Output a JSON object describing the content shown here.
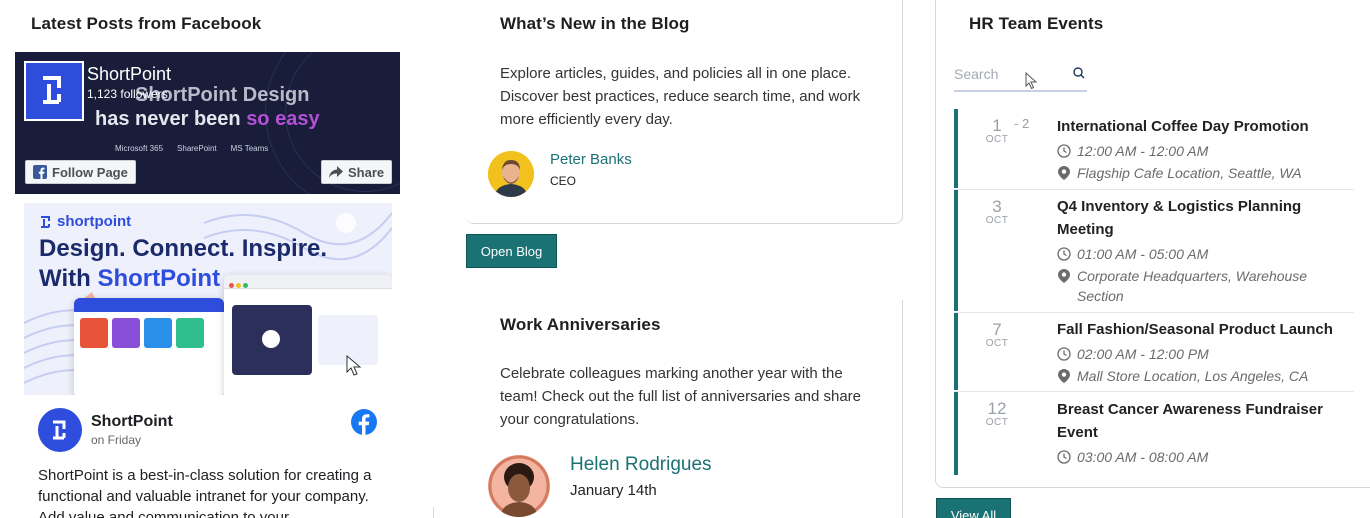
{
  "facebook": {
    "title": "Latest Posts from Facebook",
    "page_name": "ShortPoint",
    "followers": "1,123 followers",
    "banner_tagline_1": "ShortPoint Design",
    "banner_tagline_2_a": "has never been",
    "banner_tagline_2_b": "so easy",
    "partners": [
      "Microsoft 365",
      "SharePoint",
      "MS Teams"
    ],
    "follow_label": "Follow Page",
    "share_label": "Share",
    "card_brand": "shortpoint",
    "card_headline_1": "Design. Connect. Inspire.",
    "card_headline_2a": "With",
    "card_headline_2b": "ShortPoint",
    "post_author": "ShortPoint",
    "post_time": "on Friday",
    "post_text": "ShortPoint is a best-in-class solution for creating a functional and valuable intranet for your company. Add value and communication to your"
  },
  "blog": {
    "title": "What’s New in the Blog",
    "description": "Explore articles, guides, and policies all in one place. Discover best practices, reduce search time, and work more efficiently every day.",
    "author_name": "Peter Banks",
    "author_role": "CEO",
    "button_label": "Open Blog"
  },
  "anniversaries": {
    "title": "Work Anniversaries",
    "description": "Celebrate colleagues marking another year with the team! Check out the full list of anniversaries and share your congratulations.",
    "person_name": "Helen Rodrigues",
    "person_date": "January 14th"
  },
  "hr_events": {
    "title": "HR Team Events",
    "search_placeholder": "Search",
    "view_all_label": "View All",
    "events": [
      {
        "day": "1",
        "day_end": "- 2",
        "month": "OCT",
        "title": "International Coffee Day Promotion",
        "time": "12:00 AM - 12:00 AM",
        "location": "Flagship Cafe Location, Seattle, WA"
      },
      {
        "day": "3",
        "month": "OCT",
        "title": "Q4 Inventory & Logistics Planning Meeting",
        "time": "01:00 AM - 05:00 AM",
        "location": "Corporate Headquarters, Warehouse Section"
      },
      {
        "day": "7",
        "month": "OCT",
        "title": "Fall Fashion/Seasonal Product Launch",
        "time": "02:00 AM - 12:00 PM",
        "location": "Mall Store Location, Los Angeles, CA"
      },
      {
        "day": "12",
        "month": "OCT",
        "title": "Breast Cancer Awareness Fundraiser Event",
        "time": "03:00 AM - 08:00 AM",
        "location": ""
      }
    ]
  },
  "colors": {
    "accent": "#1a7275",
    "brand_blue": "#2f4ddc",
    "facebook_blue": "#1877f2"
  }
}
